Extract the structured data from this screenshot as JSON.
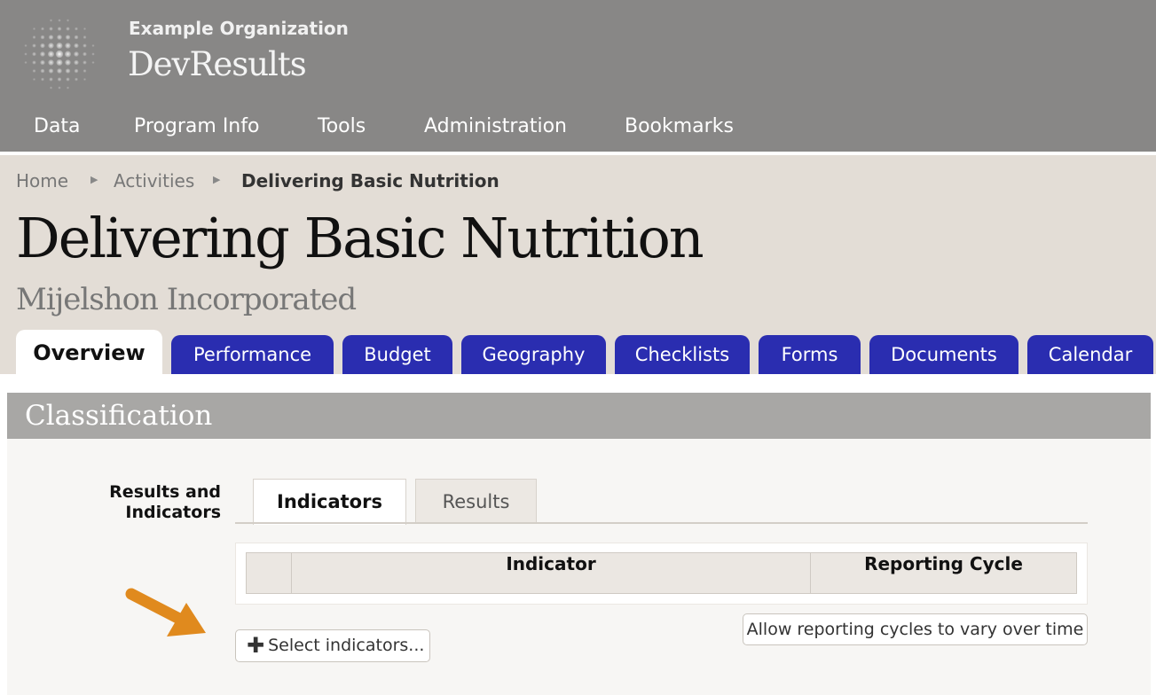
{
  "header": {
    "org_name": "Example Organization",
    "app_name": "DevResults",
    "nav": [
      "Data",
      "Program Info",
      "Tools",
      "Administration",
      "Bookmarks"
    ]
  },
  "breadcrumb": [
    "Home",
    "Activities",
    "Delivering Basic Nutrition"
  ],
  "page": {
    "title": "Delivering Basic Nutrition",
    "subtitle": "Mijelshon Incorporated"
  },
  "tabs": [
    "Overview",
    "Performance",
    "Budget",
    "Geography",
    "Checklists",
    "Forms",
    "Documents",
    "Calendar"
  ],
  "active_tab": "Overview",
  "classification": {
    "title": "Classification",
    "field_label": "Results and Indicators",
    "subtabs": [
      "Indicators",
      "Results"
    ],
    "active_subtab": "Indicators",
    "columns": [
      "",
      "Indicator",
      "Reporting Cycle"
    ],
    "select_button": "Select indicators...",
    "allow_button": "Allow reporting cycles to vary over time"
  },
  "colors": {
    "header_bg": "#888786",
    "tab_blue": "#2a2db0",
    "arrow": "#e08a1e"
  },
  "icons": {
    "logo": "globe-dots-icon",
    "breadcrumb_separator": "triangle-right-icon",
    "add": "plus-icon",
    "callout": "arrow-icon"
  }
}
